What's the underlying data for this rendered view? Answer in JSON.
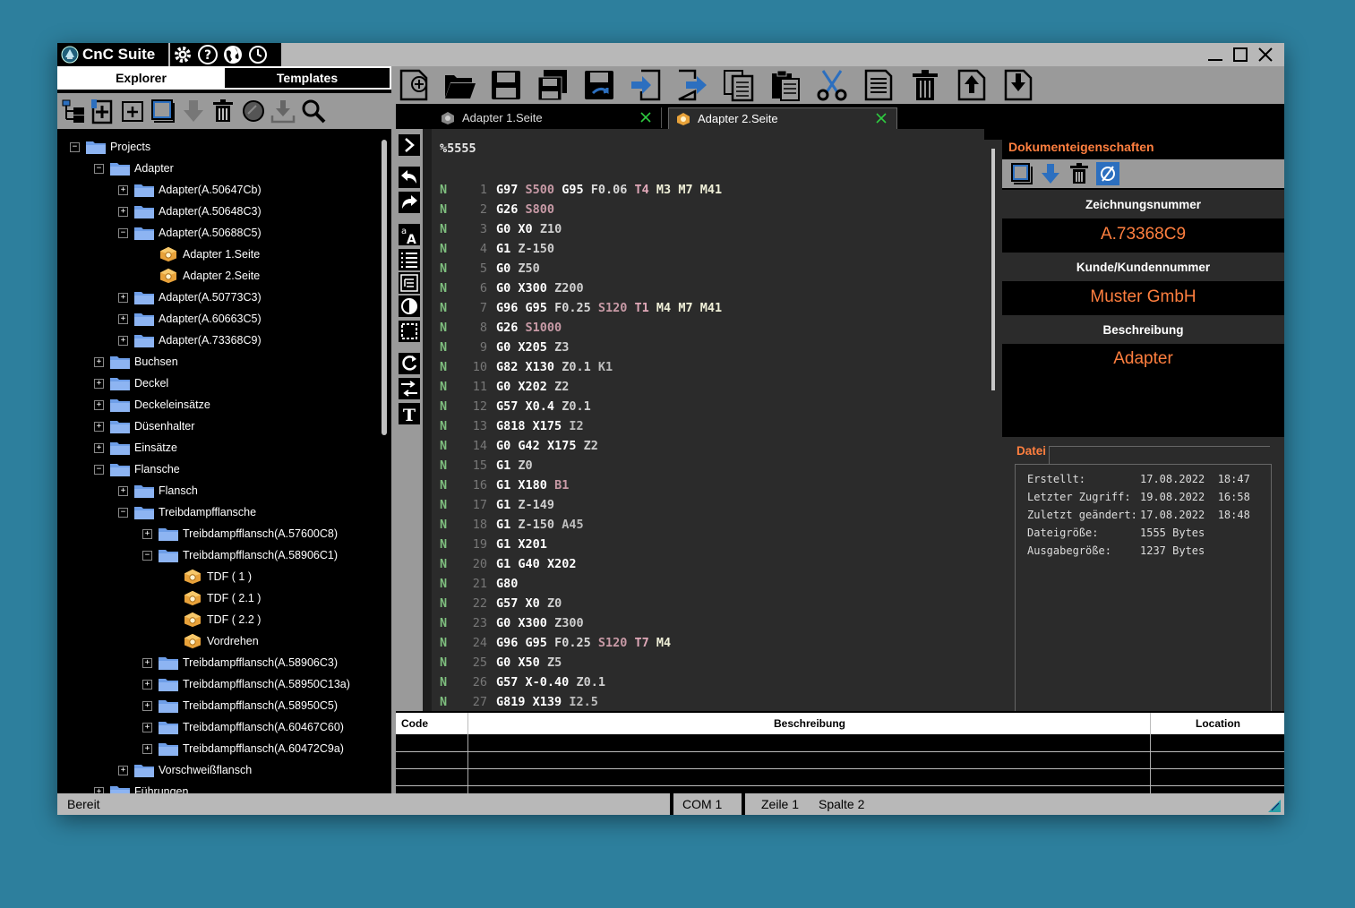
{
  "app": {
    "title": "CnC Suite"
  },
  "title_icons": [
    "gear-icon",
    "help-icon",
    "globe-icon",
    "history-icon"
  ],
  "left_tabs": {
    "explorer": "Explorer",
    "templates": "Templates"
  },
  "tree": [
    {
      "label": "Projects",
      "level": 0,
      "type": "folder",
      "exp": "-"
    },
    {
      "label": "Adapter",
      "level": 1,
      "type": "folder",
      "exp": "-"
    },
    {
      "label": "Adapter(A.50647Cb)",
      "level": 2,
      "type": "folder",
      "exp": "+"
    },
    {
      "label": "Adapter(A.50648C3)",
      "level": 2,
      "type": "folder",
      "exp": "+"
    },
    {
      "label": "Adapter(A.50688C5)",
      "level": 2,
      "type": "folder",
      "exp": "-"
    },
    {
      "label": "Adapter 1.Seite",
      "level": 3,
      "type": "file",
      "exp": ""
    },
    {
      "label": "Adapter 2.Seite",
      "level": 3,
      "type": "file",
      "exp": ""
    },
    {
      "label": "Adapter(A.50773C3)",
      "level": 2,
      "type": "folder",
      "exp": "+"
    },
    {
      "label": "Adapter(A.60663C5)",
      "level": 2,
      "type": "folder",
      "exp": "+"
    },
    {
      "label": "Adapter(A.73368C9)",
      "level": 2,
      "type": "folder",
      "exp": "+"
    },
    {
      "label": "Buchsen",
      "level": 1,
      "type": "folder",
      "exp": "+"
    },
    {
      "label": "Deckel",
      "level": 1,
      "type": "folder",
      "exp": "+"
    },
    {
      "label": "Deckeleinsätze",
      "level": 1,
      "type": "folder",
      "exp": "+"
    },
    {
      "label": "Düsenhalter",
      "level": 1,
      "type": "folder",
      "exp": "+"
    },
    {
      "label": "Einsätze",
      "level": 1,
      "type": "folder",
      "exp": "+"
    },
    {
      "label": "Flansche",
      "level": 1,
      "type": "folder",
      "exp": "-"
    },
    {
      "label": "Flansch",
      "level": 2,
      "type": "folder",
      "exp": "+"
    },
    {
      "label": "Treibdampfflansche",
      "level": 2,
      "type": "folder",
      "exp": "-"
    },
    {
      "label": "Treibdampfflansch(A.57600C8)",
      "level": 3,
      "type": "folder",
      "exp": "+"
    },
    {
      "label": "Treibdampfflansch(A.58906C1)",
      "level": 3,
      "type": "folder",
      "exp": "-"
    },
    {
      "label": "TDF ( 1 )",
      "level": 4,
      "type": "file",
      "exp": ""
    },
    {
      "label": "TDF ( 2.1 )",
      "level": 4,
      "type": "file",
      "exp": ""
    },
    {
      "label": "TDF ( 2.2 )",
      "level": 4,
      "type": "file",
      "exp": ""
    },
    {
      "label": "Vordrehen",
      "level": 4,
      "type": "file",
      "exp": ""
    },
    {
      "label": "Treibdampfflansch(A.58906C3)",
      "level": 3,
      "type": "folder",
      "exp": "+"
    },
    {
      "label": "Treibdampfflansch(A.58950C13a)",
      "level": 3,
      "type": "folder",
      "exp": "+"
    },
    {
      "label": "Treibdampfflansch(A.58950C5)",
      "level": 3,
      "type": "folder",
      "exp": "+"
    },
    {
      "label": "Treibdampfflansch(A.60467C60)",
      "level": 3,
      "type": "folder",
      "exp": "+"
    },
    {
      "label": "Treibdampfflansch(A.60472C9a)",
      "level": 3,
      "type": "folder",
      "exp": "+"
    },
    {
      "label": "Vorschweißflansch",
      "level": 2,
      "type": "folder",
      "exp": "+"
    },
    {
      "label": "Führungen",
      "level": 1,
      "type": "folder",
      "exp": "+"
    }
  ],
  "doc_tabs": [
    {
      "label": "Adapter 1.Seite",
      "active": false
    },
    {
      "label": "Adapter 2.Seite",
      "active": true
    }
  ],
  "editor": {
    "header": "%5555",
    "lines": [
      {
        "n": "N",
        "num": "1",
        "tokens": [
          [
            "G97",
            "g"
          ],
          [
            "S500",
            "s"
          ],
          [
            "G95",
            "g"
          ],
          [
            "F0.06",
            "f"
          ],
          [
            "T4",
            "t"
          ],
          [
            "M3",
            "m"
          ],
          [
            "M7",
            "m"
          ],
          [
            "M41",
            "m"
          ]
        ]
      },
      {
        "n": "N",
        "num": "2",
        "tokens": [
          [
            "G26",
            "g"
          ],
          [
            "S800",
            "s"
          ]
        ]
      },
      {
        "n": "N",
        "num": "3",
        "tokens": [
          [
            "G0",
            "g"
          ],
          [
            "X0",
            "x"
          ],
          [
            "Z10",
            "z"
          ]
        ]
      },
      {
        "n": "N",
        "num": "4",
        "tokens": [
          [
            "G1",
            "g"
          ],
          [
            "Z-150",
            "z"
          ]
        ]
      },
      {
        "n": "N",
        "num": "5",
        "tokens": [
          [
            "G0",
            "g"
          ],
          [
            "Z50",
            "z"
          ]
        ]
      },
      {
        "n": "N",
        "num": "6",
        "tokens": [
          [
            "G0",
            "g"
          ],
          [
            "X300",
            "x"
          ],
          [
            "Z200",
            "z"
          ]
        ]
      },
      {
        "n": "N",
        "num": "7",
        "tokens": [
          [
            "G96",
            "g"
          ],
          [
            "G95",
            "g"
          ],
          [
            "F0.25",
            "f"
          ],
          [
            "S120",
            "s"
          ],
          [
            "T1",
            "t"
          ],
          [
            "M4",
            "m"
          ],
          [
            "M7",
            "m"
          ],
          [
            "M41",
            "m"
          ]
        ]
      },
      {
        "n": "N",
        "num": "8",
        "tokens": [
          [
            "G26",
            "g"
          ],
          [
            "S1000",
            "s"
          ]
        ]
      },
      {
        "n": "N",
        "num": "9",
        "tokens": [
          [
            "G0",
            "g"
          ],
          [
            "X205",
            "x"
          ],
          [
            "Z3",
            "z"
          ]
        ]
      },
      {
        "n": "N",
        "num": "10",
        "tokens": [
          [
            "G82",
            "g"
          ],
          [
            "X130",
            "x"
          ],
          [
            "Z0.1",
            "z"
          ],
          [
            "K1",
            "o"
          ]
        ]
      },
      {
        "n": "N",
        "num": "11",
        "tokens": [
          [
            "G0",
            "g"
          ],
          [
            "X202",
            "x"
          ],
          [
            "Z2",
            "z"
          ]
        ]
      },
      {
        "n": "N",
        "num": "12",
        "tokens": [
          [
            "G57",
            "g"
          ],
          [
            "X0.4",
            "x"
          ],
          [
            "Z0.1",
            "z"
          ]
        ]
      },
      {
        "n": "N",
        "num": "13",
        "tokens": [
          [
            "G818",
            "g"
          ],
          [
            "X175",
            "x"
          ],
          [
            "I2",
            "o"
          ]
        ]
      },
      {
        "n": "N",
        "num": "14",
        "tokens": [
          [
            "G0",
            "g"
          ],
          [
            "G42",
            "g"
          ],
          [
            "X175",
            "x"
          ],
          [
            "Z2",
            "z"
          ]
        ]
      },
      {
        "n": "N",
        "num": "15",
        "tokens": [
          [
            "G1",
            "g"
          ],
          [
            "Z0",
            "z"
          ]
        ]
      },
      {
        "n": "N",
        "num": "16",
        "tokens": [
          [
            "G1",
            "g"
          ],
          [
            "X180",
            "x"
          ],
          [
            "B1",
            "s"
          ]
        ]
      },
      {
        "n": "N",
        "num": "17",
        "tokens": [
          [
            "G1",
            "g"
          ],
          [
            "Z-149",
            "z"
          ]
        ]
      },
      {
        "n": "N",
        "num": "18",
        "tokens": [
          [
            "G1",
            "g"
          ],
          [
            "Z-150",
            "z"
          ],
          [
            "A45",
            "o"
          ]
        ]
      },
      {
        "n": "N",
        "num": "19",
        "tokens": [
          [
            "G1",
            "g"
          ],
          [
            "X201",
            "x"
          ]
        ]
      },
      {
        "n": "N",
        "num": "20",
        "tokens": [
          [
            "G1",
            "g"
          ],
          [
            "G40",
            "g"
          ],
          [
            "X202",
            "x"
          ]
        ]
      },
      {
        "n": "N",
        "num": "21",
        "tokens": [
          [
            "G80",
            "g"
          ]
        ]
      },
      {
        "n": "N",
        "num": "22",
        "tokens": [
          [
            "G57",
            "g"
          ],
          [
            "X0",
            "x"
          ],
          [
            "Z0",
            "z"
          ]
        ]
      },
      {
        "n": "N",
        "num": "23",
        "tokens": [
          [
            "G0",
            "g"
          ],
          [
            "X300",
            "x"
          ],
          [
            "Z300",
            "z"
          ]
        ]
      },
      {
        "n": "N",
        "num": "24",
        "tokens": [
          [
            "G96",
            "g"
          ],
          [
            "G95",
            "g"
          ],
          [
            "F0.25",
            "f"
          ],
          [
            "S120",
            "s"
          ],
          [
            "T7",
            "t"
          ],
          [
            "M4",
            "m"
          ]
        ]
      },
      {
        "n": "N",
        "num": "25",
        "tokens": [
          [
            "G0",
            "g"
          ],
          [
            "X50",
            "x"
          ],
          [
            "Z5",
            "z"
          ]
        ]
      },
      {
        "n": "N",
        "num": "26",
        "tokens": [
          [
            "G57",
            "g"
          ],
          [
            "X-0.40",
            "x"
          ],
          [
            "Z0.1",
            "z"
          ]
        ]
      },
      {
        "n": "N",
        "num": "27",
        "tokens": [
          [
            "G819",
            "g"
          ],
          [
            "X139",
            "x"
          ],
          [
            "I2.5",
            "o"
          ]
        ]
      }
    ]
  },
  "properties": {
    "title": "Dokumenteigenschaften",
    "drawing_label": "Zeichnungsnummer",
    "drawing_value": "A.73368C9",
    "customer_label": "Kunde/Kundennummer",
    "customer_value": "Muster GmbH",
    "desc_label": "Beschreibung",
    "desc_value": "Adapter"
  },
  "file_info": {
    "title": "Datei",
    "rows": [
      {
        "k": "Erstellt:",
        "v": "17.08.2022  18:47"
      },
      {
        "k": "Letzter Zugriff:",
        "v": "19.08.2022  16:58"
      },
      {
        "k": "Zuletzt geändert:",
        "v": "17.08.2022  18:48"
      },
      {
        "k": "Dateigröße:",
        "v": "1555 Bytes"
      },
      {
        "k": "Ausgabegröße:",
        "v": "1237 Bytes"
      }
    ]
  },
  "error_list": {
    "col_code": "Code",
    "col_desc": "Beschreibung",
    "col_loc": "Location"
  },
  "status": {
    "state": "Bereit",
    "port": "COM 1",
    "line": "Zeile 1",
    "col": "Spalte 2"
  },
  "colors": {
    "accent": "#ff7f3f",
    "nline": "#7fbf7f",
    "toolbar": "#9a9a9a",
    "folder": "#6e9ee8"
  }
}
